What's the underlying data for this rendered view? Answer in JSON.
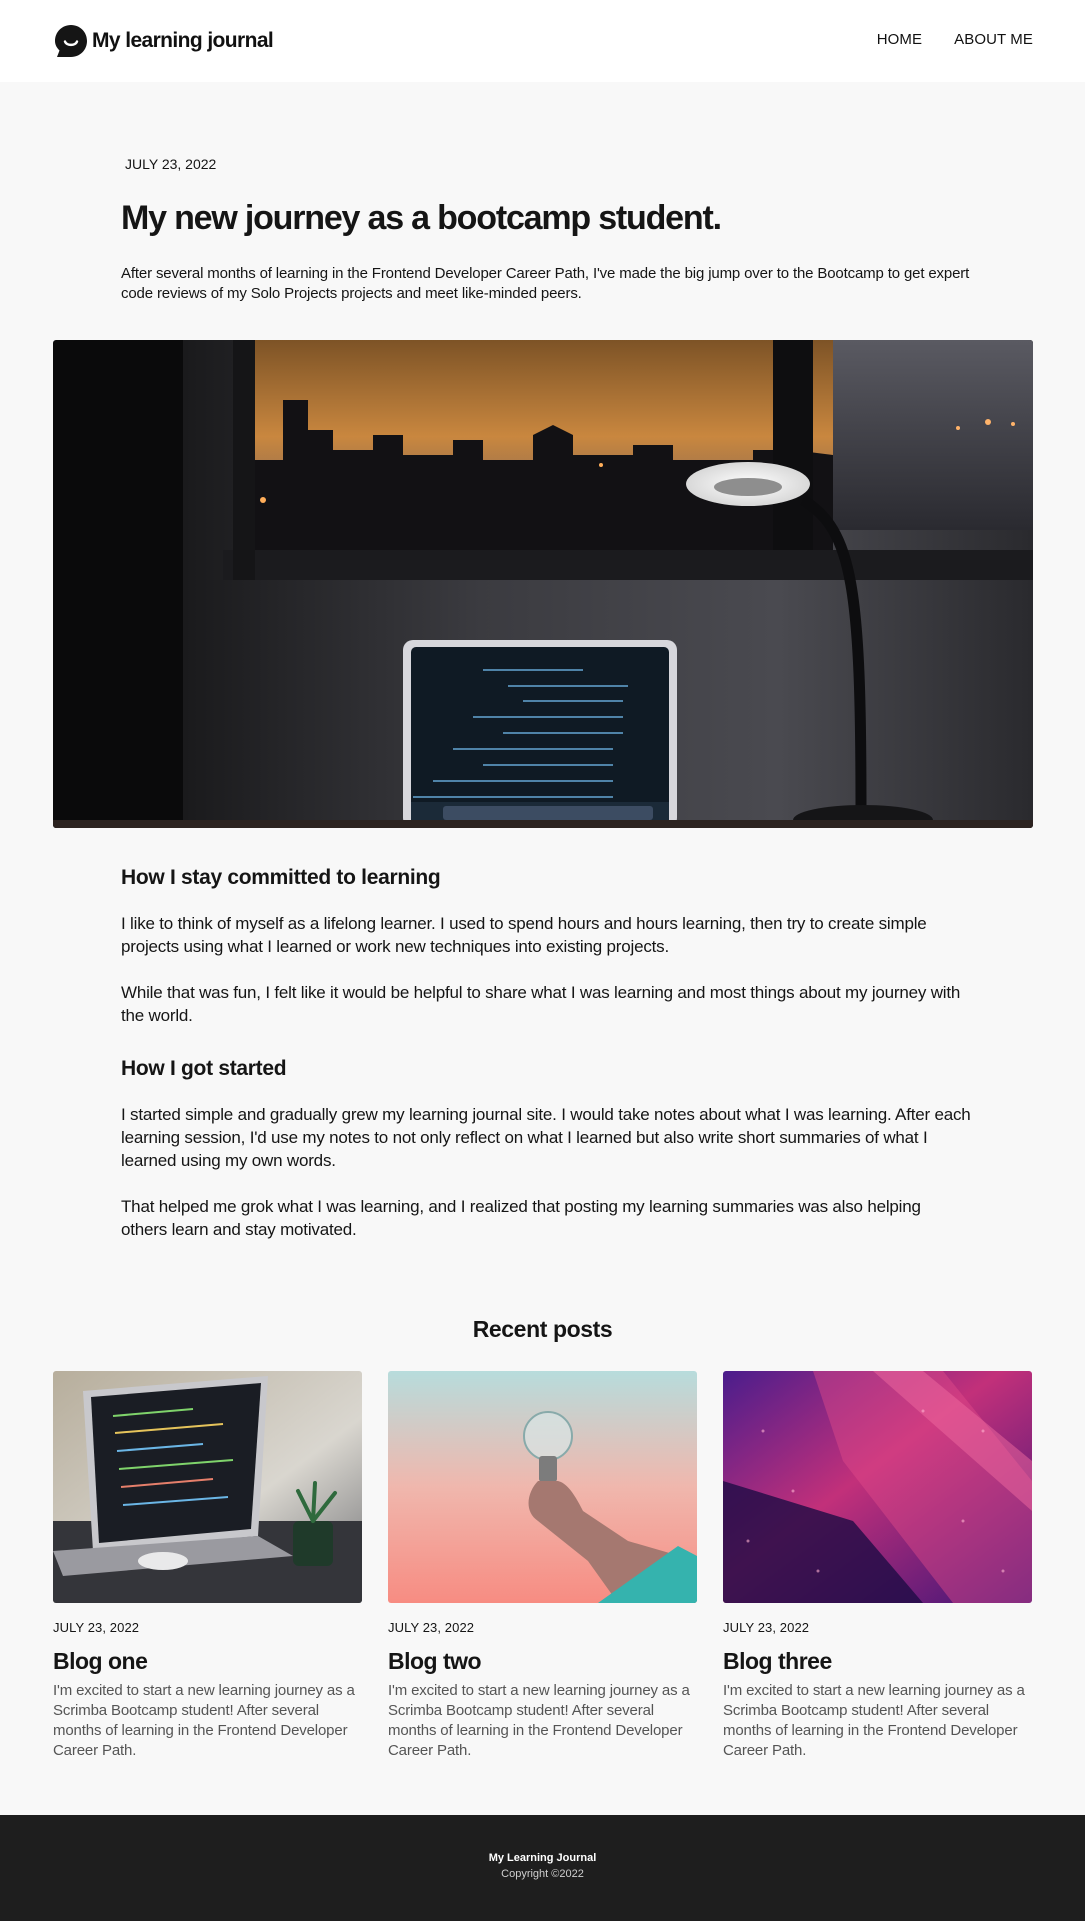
{
  "header": {
    "logo_icon": "chat-bubble-smile-icon",
    "site_title": "My learning journal",
    "nav": [
      {
        "label": "HOME"
      },
      {
        "label": "ABOUT ME"
      }
    ]
  },
  "hero": {
    "date": "JULY 23, 2022",
    "title": "My new journey as a bootcamp student.",
    "description": "After several months of learning in the Frontend Developer Career Path, I've made the big jump over to the Bootcamp to get expert code reviews of my Solo Projects projects and meet like-minded peers.",
    "image": "desk-laptop-lamp-sunset-photo"
  },
  "article": {
    "sections": [
      {
        "heading": "How I stay committed to learning",
        "paragraphs": [
          "I like to think of myself as a lifelong learner. I used to spend hours and hours learning, then try to create simple projects using what I learned or work new techniques into existing projects.",
          "While that was fun, I felt like it would be helpful to share what I was learning and most things about my journey with the world."
        ]
      },
      {
        "heading": "How I got started",
        "paragraphs": [
          "I started simple and gradually grew my learning journal site. I would take notes about what I was learning. After each learning session, I'd use my notes to not only reflect on what I learned but also write short summaries of what I learned using my own words.",
          "That helped me grok what I was learning, and I realized that posting my learning summaries was also helping others learn and stay motivated."
        ]
      }
    ]
  },
  "recent": {
    "title": "Recent posts",
    "posts": [
      {
        "image": "laptop-code-plant-photo",
        "date": "JULY 23, 2022",
        "title": "Blog one",
        "excerpt": "I'm excited to start a new learning journey as a Scrimba Bootcamp student! After several months of learning in the Frontend Developer Career Path."
      },
      {
        "image": "hand-holding-lightbulb-photo",
        "date": "JULY 23, 2022",
        "title": "Blog two",
        "excerpt": "I'm excited to start a new learning journey as a Scrimba Bootcamp student! After several months of learning in the Frontend Developer Career Path."
      },
      {
        "image": "purple-abstract-light-photo",
        "date": "JULY 23, 2022",
        "title": "Blog three",
        "excerpt": "I'm excited to start a new learning journey as a Scrimba Bootcamp student! After several months of learning in the Frontend Developer Career Path."
      }
    ]
  },
  "footer": {
    "title": "My Learning Journal",
    "copyright": "Copyright ©2022"
  },
  "colors": {
    "page_bg": "#f8f8f8",
    "text": "#151515",
    "footer_bg": "#1e1e1e",
    "excerpt_text": "#555555"
  }
}
